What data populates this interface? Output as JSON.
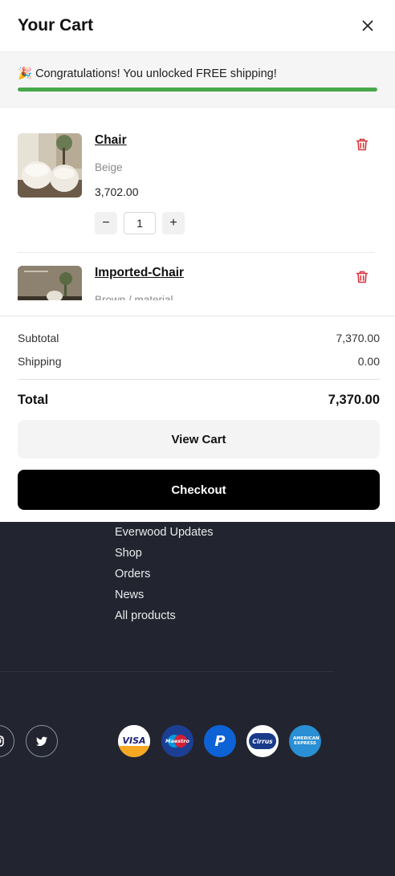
{
  "cart": {
    "title": "Your Cart",
    "shipping": {
      "emoji": "🎉",
      "message": "Congratulations! You unlocked FREE shipping!",
      "progress": 1.0,
      "progress_color": "#47a84a"
    },
    "items": [
      {
        "name": "Chair",
        "variant": "Beige",
        "price": "3,702.00",
        "quantity": "1",
        "minus_label": "−",
        "plus_label": "+"
      },
      {
        "name": "Imported-Chair",
        "variant": "Brown / material"
      }
    ],
    "summary": {
      "subtotal_label": "Subtotal",
      "subtotal_value": "7,370.00",
      "shipping_label": "Shipping",
      "shipping_value": "0.00",
      "total_label": "Total",
      "total_value": "7,370.00"
    },
    "view_cart_label": "View Cart",
    "checkout_label": "Checkout"
  },
  "footer": {
    "links": [
      "Everwood Updates",
      "Shop",
      "Orders",
      "News",
      "All products"
    ],
    "social_icons": [
      "instagram-icon",
      "twitter-icon"
    ],
    "payment_methods": [
      "visa-icon",
      "maestro-icon",
      "paypal-icon",
      "cirrus-icon",
      "american-express-icon"
    ],
    "payment_labels": {
      "visa": "VISA",
      "maestro": "Maestro",
      "paypal": "P",
      "cirrus": "Cirrus",
      "amex": "AMERICAN EXPRESS"
    }
  },
  "colors": {
    "footer_bg": "#22252f",
    "checkout_bg": "#000000",
    "trash_red": "#d9363e"
  }
}
